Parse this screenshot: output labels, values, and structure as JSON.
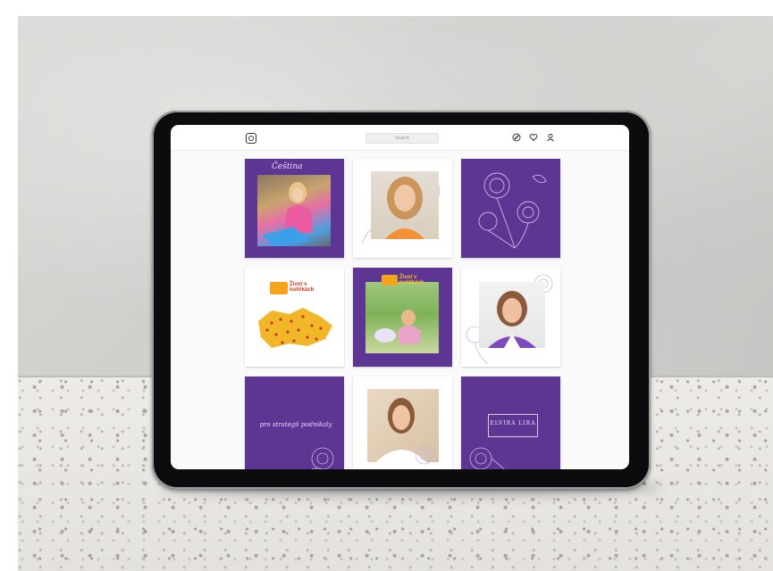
{
  "colors": {
    "accent": "#5d3593",
    "map_yellow": "#f2b729",
    "map_dots": "#c8381c",
    "badge_orange": "#f4a31c"
  },
  "topbar": {
    "logo_icon": "camera-icon",
    "search_placeholder": "Search",
    "icons": [
      "compass-icon",
      "heart-icon",
      "profile-icon"
    ]
  },
  "tiles": [
    {
      "id": "girl-writing",
      "script": "Čeština"
    },
    {
      "id": "portrait-blonde"
    },
    {
      "id": "floral-line-art"
    },
    {
      "id": "map-czech",
      "badge": "Život v kuličkách"
    },
    {
      "id": "child-garden",
      "badge": "Život v kuličkách"
    },
    {
      "id": "portrait-purple-jacket"
    },
    {
      "id": "purple-quote",
      "script": "pro strategii podnikaly"
    },
    {
      "id": "portrait-white-shirt"
    },
    {
      "id": "purple-logo",
      "logo_line1": "ELVIRA LIRA"
    }
  ]
}
